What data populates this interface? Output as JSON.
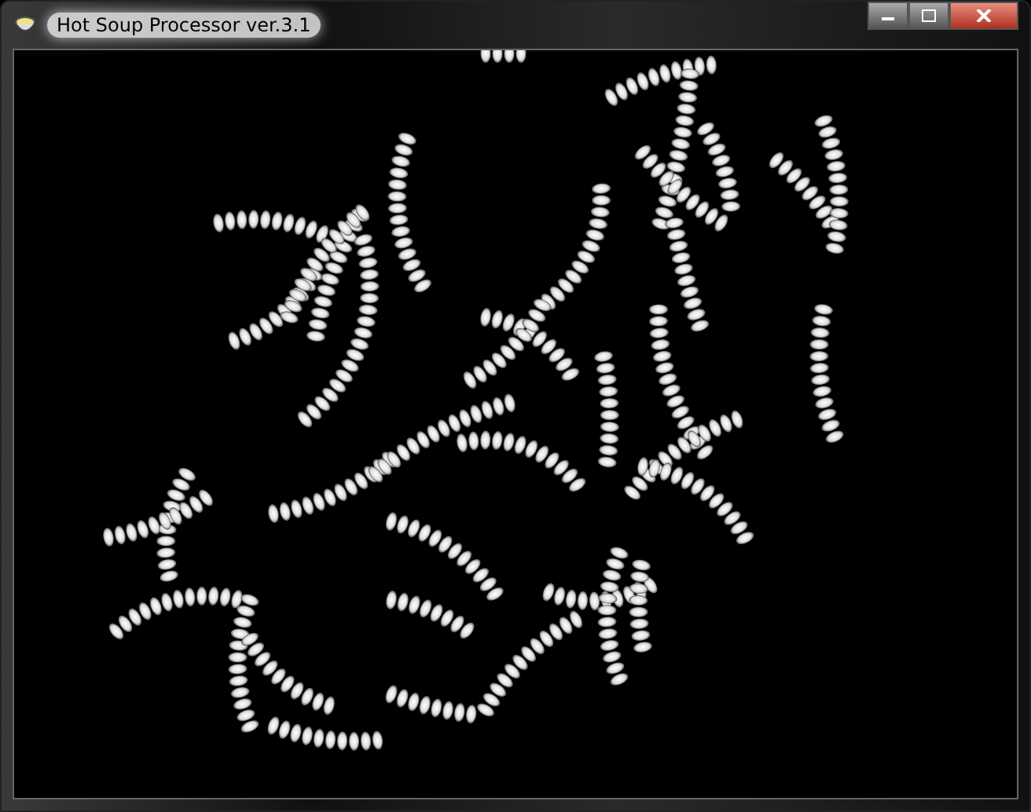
{
  "window": {
    "title": "Hot Soup Processor ver.3.1"
  }
}
